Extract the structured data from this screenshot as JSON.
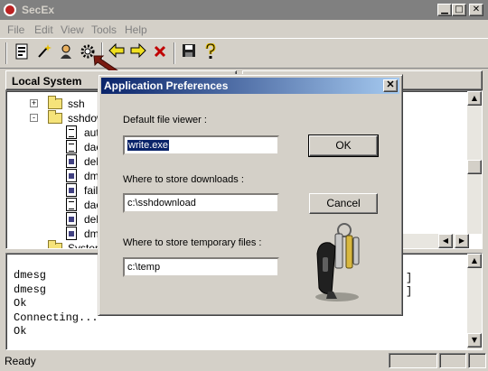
{
  "window": {
    "title": "SecEx"
  },
  "menu": [
    "File",
    "Edit",
    "View",
    "Tools",
    "Help"
  ],
  "toolbar": {
    "buttons": [
      "properties-icon",
      "wand-icon",
      "user-icon",
      "gear-icon",
      "back-arrow-icon",
      "forward-arrow-icon",
      "delete-icon",
      "save-icon",
      "help-icon"
    ]
  },
  "local_panel": {
    "header": "Local System",
    "tree": [
      {
        "label": "ssh",
        "kind": "folder",
        "expand": "+"
      },
      {
        "label": "sshdownl",
        "kind": "folder",
        "expand": "-"
      },
      {
        "label": "auth.",
        "kind": "doc"
      },
      {
        "label": "daem",
        "kind": "doc"
      },
      {
        "label": "debu",
        "kind": "exec"
      },
      {
        "label": "dmes",
        "kind": "exec"
      },
      {
        "label": "faillog",
        "kind": "exec"
      },
      {
        "label": "daem",
        "kind": "doc"
      },
      {
        "label": "debu",
        "kind": "exec"
      },
      {
        "label": "dmes",
        "kind": "exec"
      },
      {
        "label": "System V",
        "kind": "folder"
      }
    ]
  },
  "log": {
    "lines": [
      "dmesg",
      "dmesg",
      "Ok",
      "Connecting...",
      "Ok"
    ],
    "right_fragments": [
      "]",
      "]"
    ]
  },
  "statusbar": {
    "text": "Ready"
  },
  "dialog": {
    "title": "Application Preferences",
    "close_glyph": "✕",
    "viewer_label": "Default file viewer :",
    "viewer_value": "write.exe",
    "downloads_label": "Where to store downloads :",
    "downloads_value": "c:\\sshdownload",
    "temp_label": "Where to store temporary files :",
    "temp_value": "c:\\temp",
    "ok_label": "OK",
    "cancel_label": "Cancel"
  },
  "colors": {
    "dialog_title_start": "#0a246a",
    "dialog_title_end": "#a6caf0",
    "face": "#d4d0c8",
    "pointer_arrow": "#7a1a10"
  }
}
